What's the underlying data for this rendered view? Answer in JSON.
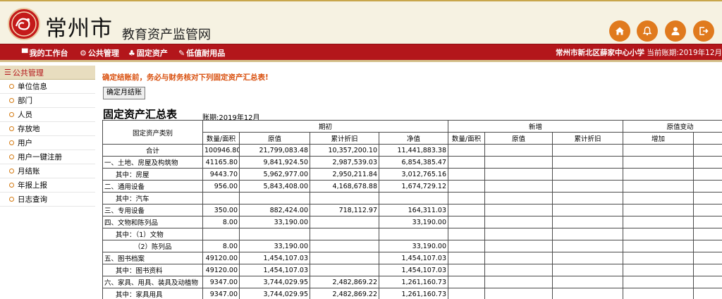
{
  "header": {
    "city": "常州市",
    "subtitle": "教育资产监管网",
    "buttons": [
      "home-icon",
      "bell-icon",
      "user-icon",
      "logout-icon"
    ]
  },
  "nav": {
    "items": [
      "我的工作台",
      "公共管理",
      "固定资产",
      "低值耐用品"
    ],
    "school": "常州市新北区薛家中心小学",
    "period_label": "当前账期:2019年12月"
  },
  "sidebar": {
    "title": "公共管理",
    "items": [
      "单位信息",
      "部门",
      "人员",
      "存放地",
      "用户",
      "用户一键注册",
      "月结账",
      "年报上报",
      "日志查询"
    ]
  },
  "main": {
    "warning": "确定结账前，务必与财务核对下列固定资产汇总表!",
    "confirm_button": "确定月结账",
    "title": "固定资产汇总表",
    "period": "账期:2019年12月"
  },
  "table": {
    "col_category": "固定资产类别",
    "group_initial": "期初",
    "group_new": "新增",
    "group_change": "原值变动",
    "sub_headers": [
      "数量/面积",
      "原值",
      "累计折旧",
      "净值",
      "数量/面积",
      "原值",
      "累计折旧",
      "增加"
    ],
    "rows": [
      [
        "合计",
        "100946.80",
        "21,799,083.48",
        "10,357,200.10",
        "11,441,883.38"
      ],
      [
        "一、土地、房屋及构筑物",
        "41165.80",
        "9,841,924.50",
        "2,987,539.03",
        "6,854,385.47"
      ],
      [
        "其中：房屋",
        "9443.70",
        "5,962,977.00",
        "2,950,211.84",
        "3,012,765.16"
      ],
      [
        "二、通用设备",
        "956.00",
        "5,843,408.00",
        "4,168,678.88",
        "1,674,729.12"
      ],
      [
        "其中：汽车",
        "",
        "",
        "",
        ""
      ],
      [
        "三、专用设备",
        "350.00",
        "882,424.00",
        "718,112.97",
        "164,311.03"
      ],
      [
        "四、文物和陈列品",
        "8.00",
        "33,190.00",
        "",
        "33,190.00"
      ],
      [
        "其中：（1）文物",
        "",
        "",
        "",
        ""
      ],
      [
        "（2）陈列品",
        "8.00",
        "33,190.00",
        "",
        "33,190.00"
      ],
      [
        "五、图书档案",
        "49120.00",
        "1,454,107.03",
        "",
        "1,454,107.03"
      ],
      [
        "其中：图书资料",
        "49120.00",
        "1,454,107.03",
        "",
        "1,454,107.03"
      ],
      [
        "六、家具、用具、装具及动植物",
        "9347.00",
        "3,744,029.95",
        "2,482,869.22",
        "1,261,160.73"
      ],
      [
        "其中：家具用具",
        "9347.00",
        "3,744,029.95",
        "2,482,869.22",
        "1,261,160.73"
      ]
    ]
  },
  "colors": {
    "nav_red": "#b3161b",
    "button_orange": "#e07a1e",
    "warning_orange": "#d9500f",
    "header_bg": "#f6f2e2"
  }
}
